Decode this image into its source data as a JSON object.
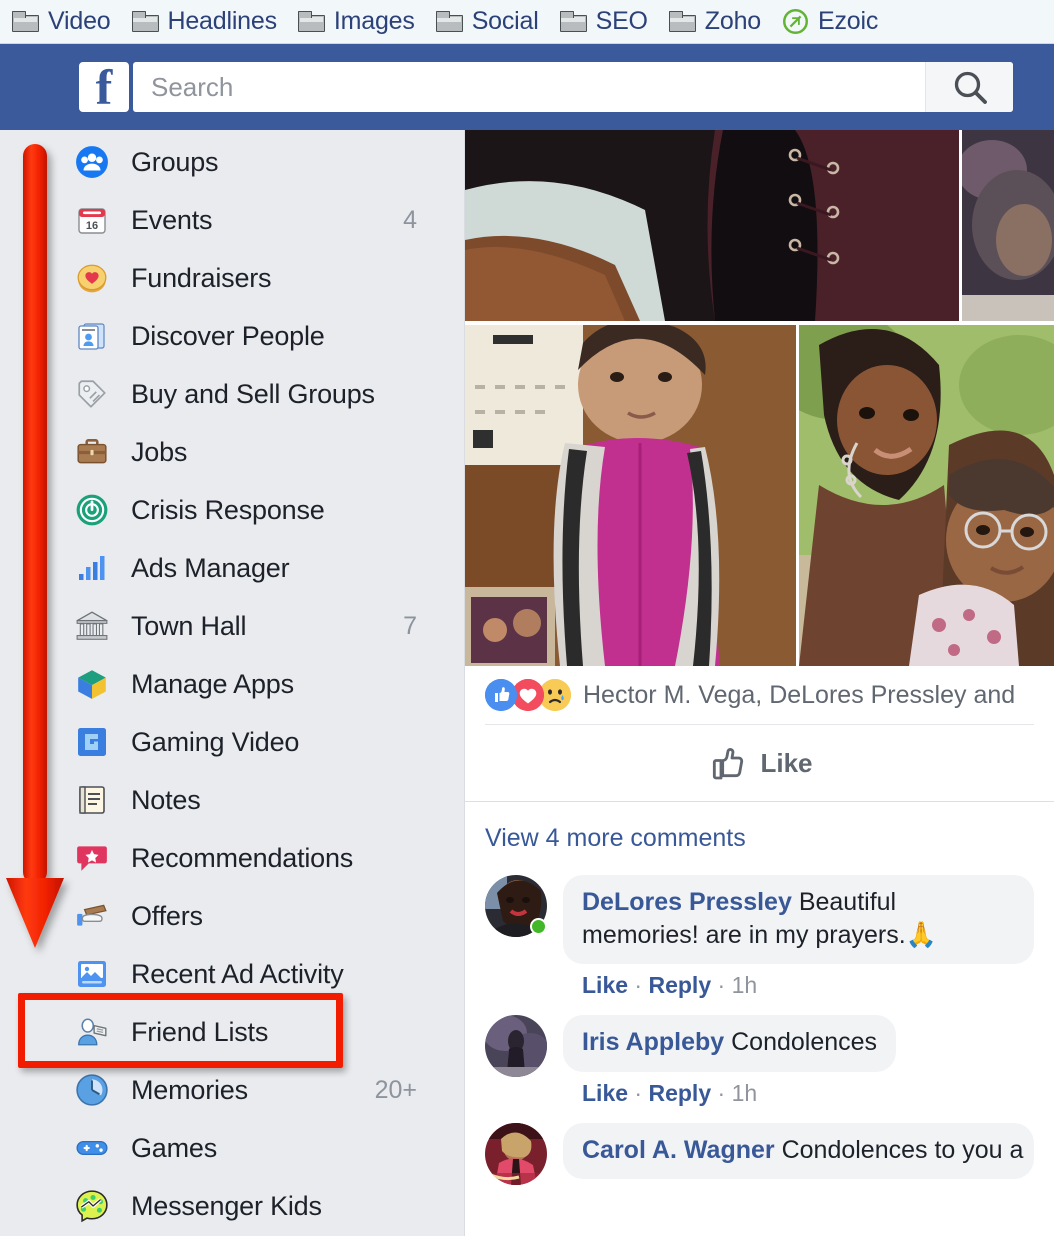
{
  "browser": {
    "bookmarks": [
      {
        "label": "Video",
        "icon": "folder-icon"
      },
      {
        "label": "Headlines",
        "icon": "folder-icon"
      },
      {
        "label": "Images",
        "icon": "folder-icon"
      },
      {
        "label": "Social",
        "icon": "folder-icon"
      },
      {
        "label": "SEO",
        "icon": "folder-icon"
      },
      {
        "label": "Zoho",
        "icon": "folder-icon"
      },
      {
        "label": "Ezoic",
        "icon": "ezoic-icon"
      }
    ]
  },
  "header": {
    "logo": "facebook-f-logo",
    "logo_letter": "f",
    "search_placeholder": "Search",
    "search_value": "",
    "search_icon": "search-icon",
    "brand_color": "#3b5a9b"
  },
  "sidebar": {
    "background_color": "#e9ebee",
    "items": [
      {
        "label": "Groups",
        "icon": "groups-icon",
        "badge": ""
      },
      {
        "label": "Events",
        "icon": "calendar-icon",
        "badge": "4"
      },
      {
        "label": "Fundraisers",
        "icon": "fundraiser-heart-icon",
        "badge": ""
      },
      {
        "label": "Discover People",
        "icon": "discover-people-icon",
        "badge": ""
      },
      {
        "label": "Buy and Sell Groups",
        "icon": "price-tag-icon",
        "badge": ""
      },
      {
        "label": "Jobs",
        "icon": "briefcase-icon",
        "badge": ""
      },
      {
        "label": "Crisis Response",
        "icon": "crisis-response-icon",
        "badge": ""
      },
      {
        "label": "Ads Manager",
        "icon": "bar-chart-icon",
        "badge": ""
      },
      {
        "label": "Town Hall",
        "icon": "government-building-icon",
        "badge": "7"
      },
      {
        "label": "Manage Apps",
        "icon": "cube-icon",
        "badge": ""
      },
      {
        "label": "Gaming Video",
        "icon": "gaming-video-icon",
        "badge": ""
      },
      {
        "label": "Notes",
        "icon": "notepad-icon",
        "badge": ""
      },
      {
        "label": "Recommendations",
        "icon": "recommendation-star-icon",
        "badge": ""
      },
      {
        "label": "Offers",
        "icon": "offers-icon",
        "badge": ""
      },
      {
        "label": "Recent Ad Activity",
        "icon": "image-frame-icon",
        "badge": ""
      },
      {
        "label": "Friend Lists",
        "icon": "friend-lists-icon",
        "badge": ""
      },
      {
        "label": "Memories",
        "icon": "clock-memories-icon",
        "badge": "20+"
      },
      {
        "label": "Games",
        "icon": "gamepad-icon",
        "badge": ""
      },
      {
        "label": "Messenger Kids",
        "icon": "messenger-kids-icon",
        "badge": ""
      }
    ]
  },
  "post": {
    "reactions": {
      "icons": [
        "like-reaction-icon",
        "love-reaction-icon",
        "sad-reaction-icon"
      ],
      "names_text": "Hector M. Vega, DeLores Pressley and"
    },
    "like_button": {
      "label": "Like",
      "icon": "thumbs-up-icon"
    },
    "view_more_comments": "View 4 more comments",
    "comments": [
      {
        "author": "DeLores Pressley",
        "text": "Beautiful memories! are in my prayers.🙏",
        "actions": {
          "like": "Like",
          "reply": "Reply",
          "time": "1h"
        },
        "online": true
      },
      {
        "author": "Iris Appleby",
        "text": "Condolences",
        "actions": {
          "like": "Like",
          "reply": "Reply",
          "time": "1h"
        },
        "online": false
      },
      {
        "author": "Carol A. Wagner",
        "text": "Condolences to you a",
        "actions": {
          "like": "",
          "reply": "",
          "time": ""
        },
        "online": false
      }
    ]
  },
  "annotation": {
    "arrow_color": "#f21d00",
    "highlight_target": "Friend Lists",
    "highlight_color": "#f21d00"
  }
}
